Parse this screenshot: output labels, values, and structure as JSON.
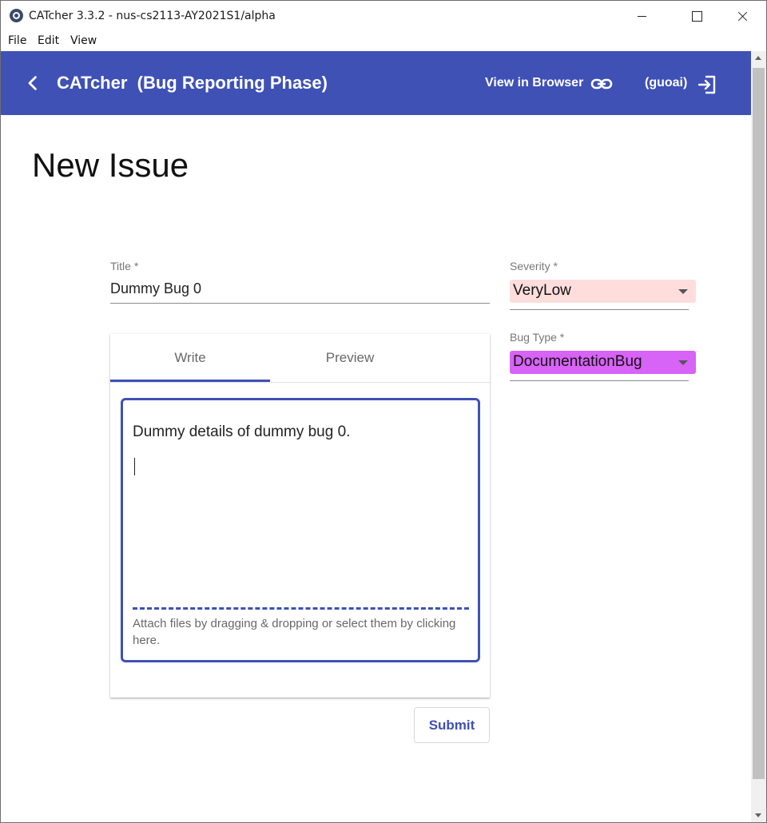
{
  "window": {
    "title": "CATcher 3.3.2 - nus-cs2113-AY2021S1/alpha",
    "icon": "catcher-app-icon"
  },
  "menu": {
    "items": [
      "File",
      "Edit",
      "View"
    ]
  },
  "toolbar": {
    "title": "CATcher  (Bug Reporting Phase)",
    "view_in_browser": "View in Browser",
    "user": "(guoai)",
    "background": "#3f51b5"
  },
  "page": {
    "title": "New Issue"
  },
  "form": {
    "title_label": "Title *",
    "title_value": "Dummy Bug 0",
    "severity": {
      "label": "Severity *",
      "value": "VeryLow",
      "color": "#ffdddd"
    },
    "bug_type": {
      "label": "Bug Type *",
      "value": "DocumentationBug",
      "color": "#d863f7"
    },
    "tabs": [
      "Write",
      "Preview"
    ],
    "active_tab": "Write",
    "description": "Dummy details of dummy bug 0.",
    "attach_hint": "Attach files by dragging & dropping or select them by clicking here.",
    "submit_label": "Submit"
  }
}
